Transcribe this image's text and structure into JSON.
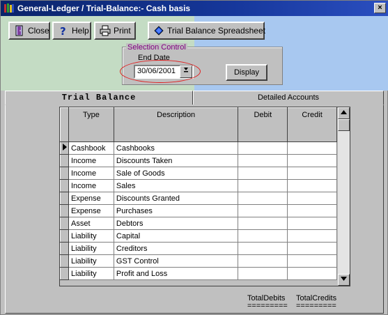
{
  "window": {
    "title": "General-Ledger / Trial-Balance:-  Cash basis",
    "close_glyph": "×"
  },
  "toolbar": {
    "close_label": "Close",
    "help_label": "Help",
    "print_label": "Print",
    "spreadsheet_label": "Trial Balance Spreadsheet"
  },
  "selection": {
    "legend": "Selection Control",
    "end_date_label": "End Date",
    "end_date_value": "30/06/2001",
    "display_label": "Display"
  },
  "tabs": [
    {
      "label": "Trial Balance",
      "active": true
    },
    {
      "label": "Detailed Accounts",
      "active": false
    }
  ],
  "grid": {
    "columns": [
      "Type",
      "Description",
      "Debit",
      "Credit"
    ],
    "rows": [
      {
        "type": "Cashbook",
        "description": "Cashbooks",
        "debit": "",
        "credit": "",
        "current": true
      },
      {
        "type": "Income",
        "description": "Discounts Taken",
        "debit": "",
        "credit": ""
      },
      {
        "type": "Income",
        "description": "Sale of Goods",
        "debit": "",
        "credit": ""
      },
      {
        "type": "Income",
        "description": "Sales",
        "debit": "",
        "credit": ""
      },
      {
        "type": "Expense",
        "description": "Discounts Granted",
        "debit": "",
        "credit": ""
      },
      {
        "type": "Expense",
        "description": "Purchases",
        "debit": "",
        "credit": ""
      },
      {
        "type": "Asset",
        "description": "Debtors",
        "debit": "",
        "credit": ""
      },
      {
        "type": "Liability",
        "description": "Capital",
        "debit": "",
        "credit": ""
      },
      {
        "type": "Liability",
        "description": "Creditors",
        "debit": "",
        "credit": ""
      },
      {
        "type": "Liability",
        "description": "GST Control",
        "debit": "",
        "credit": ""
      },
      {
        "type": "Liability",
        "description": "Profit and Loss",
        "debit": "",
        "credit": ""
      }
    ]
  },
  "totals": {
    "debits_label": "TotalDebits",
    "debits_rule": "=========",
    "credits_label": "TotalCredits",
    "credits_rule": "========="
  },
  "colors": {
    "titlebar": "#0a246a",
    "legend_text": "#800080",
    "highlight_oval": "#e02020",
    "top_bg_blue": "#a8c8f0",
    "top_bg_green": "#c4dcc4"
  }
}
